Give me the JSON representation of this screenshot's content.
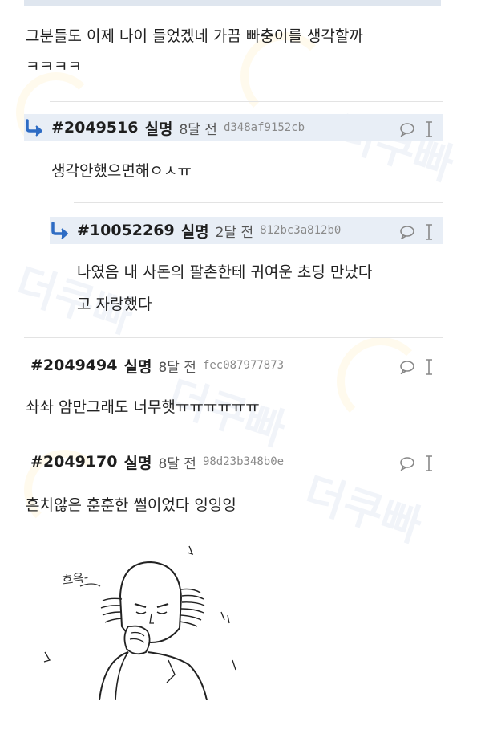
{
  "first_comment": {
    "line1": "그분들도 이제 나이 들었겠네 가끔 빠충이를 생각할까",
    "line2": "ㅋㅋㅋㅋ"
  },
  "comments": [
    {
      "id": "#2049516",
      "author": "실명",
      "time": "8달 전",
      "hash": "d348af9152cb",
      "text": [
        "생각안했으면해ㅇㅅㅠ"
      ]
    },
    {
      "id": "#10052269",
      "author": "실명",
      "time": "2달 전",
      "hash": "812bc3a812b0",
      "text": [
        "나였음 내 사돈의 팔촌한테 귀여운 초딩 만났다",
        "고 자랑했다"
      ]
    },
    {
      "id": "#2049494",
      "author": "실명",
      "time": "8달 전",
      "hash": "fec087977873",
      "text": [
        "솨솨 암만그래도 너무햇ㅠㅠㅠㅠㅠㅠ"
      ]
    },
    {
      "id": "#2049170",
      "author": "실명",
      "time": "8달 전",
      "hash": "98d23b348b0e",
      "text": [
        "흔치않은 훈훈한 썰이었다 잉잉잉"
      ]
    }
  ],
  "sticker": {
    "caption": "흐윽-",
    "icon": "crying-bald-man-drawing"
  },
  "watermark": "더쿠빠",
  "colors": {
    "reply_header_bg": "#e8eef6",
    "reply_arrow": "#2e6cc4"
  }
}
